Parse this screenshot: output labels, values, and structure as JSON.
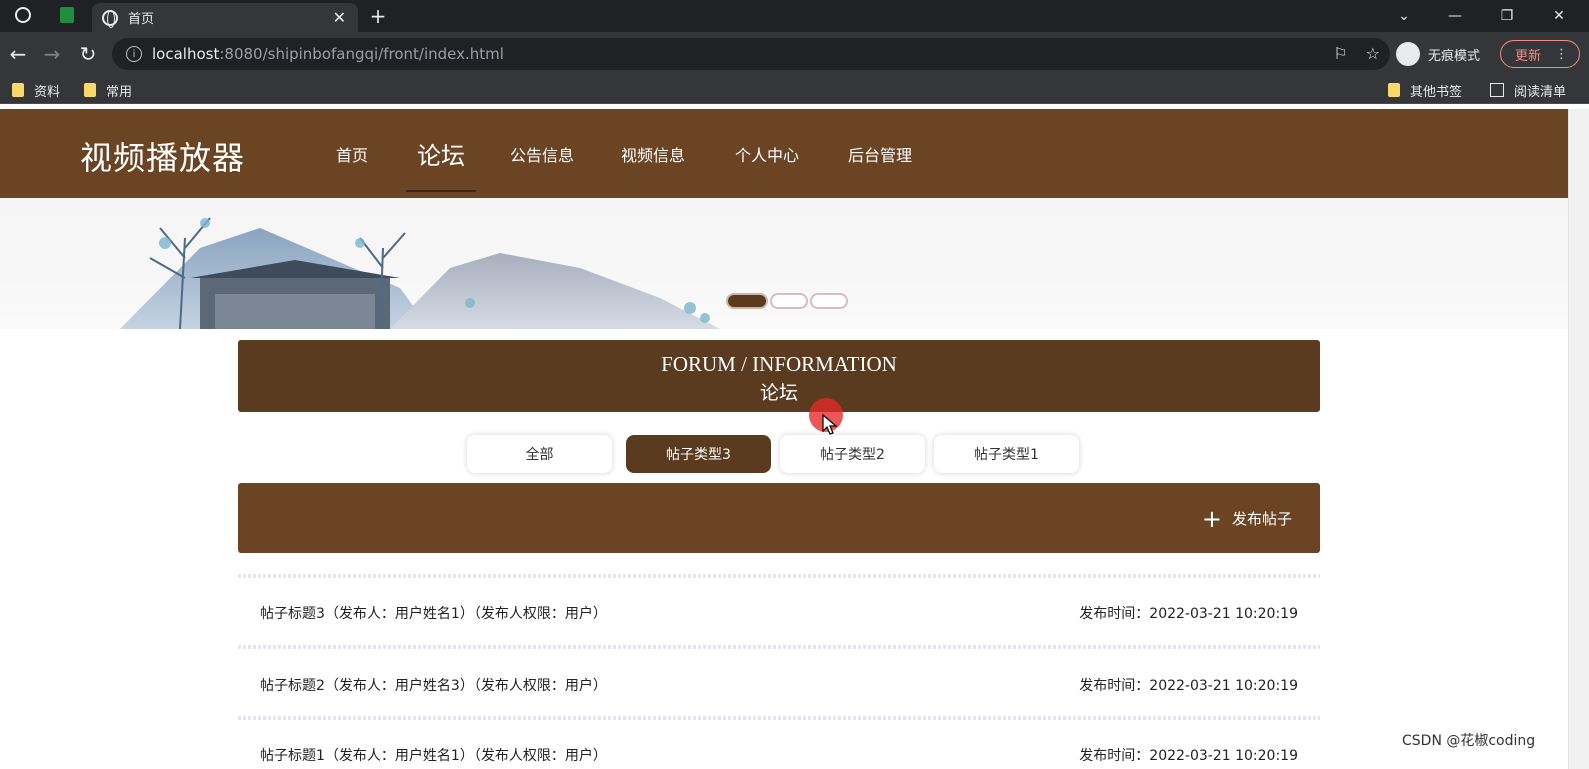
{
  "browser": {
    "tab_title": "首页",
    "url_host": "localhost",
    "url_rest": ":8080/shipinbofangqi/front/index.html",
    "incognito_label": "无痕模式",
    "update_label": "更新",
    "bookmarks": [
      {
        "label": "资料"
      },
      {
        "label": "常用"
      },
      {
        "label": "其他书签"
      },
      {
        "label": "阅读清单"
      }
    ]
  },
  "site": {
    "title": "视频播放器",
    "nav": [
      {
        "label": "首页",
        "active": false
      },
      {
        "label": "论坛",
        "active": true
      },
      {
        "label": "公告信息",
        "active": false
      },
      {
        "label": "视频信息",
        "active": false
      },
      {
        "label": "个人中心",
        "active": false
      },
      {
        "label": "后台管理",
        "active": false
      }
    ],
    "carousel": {
      "count": 3,
      "active_index": 0
    }
  },
  "forum": {
    "title_en": "FORUM / INFORMATION",
    "title_cn": "论坛",
    "filters": [
      {
        "label": "全部",
        "active": false
      },
      {
        "label": "帖子类型3",
        "active": true
      },
      {
        "label": "帖子类型2",
        "active": false
      },
      {
        "label": "帖子类型1",
        "active": false
      }
    ],
    "publish_label": "发布帖子",
    "posts": [
      {
        "title": "帖子标题3（发布人：用户姓名1）（发布人权限：用户）",
        "time": "发布时间：2022-03-21 10:20:19"
      },
      {
        "title": "帖子标题2（发布人：用户姓名3）（发布人权限：用户）",
        "time": "发布时间：2022-03-21 10:20:19"
      },
      {
        "title": "帖子标题1（发布人：用户姓名1）（发布人权限：用户）",
        "time": "发布时间：2022-03-21 10:20:19"
      }
    ]
  },
  "watermark": "CSDN @花椒coding",
  "colors": {
    "brand_brown": "#6b4423",
    "dark_brown": "#5a3b1f"
  }
}
